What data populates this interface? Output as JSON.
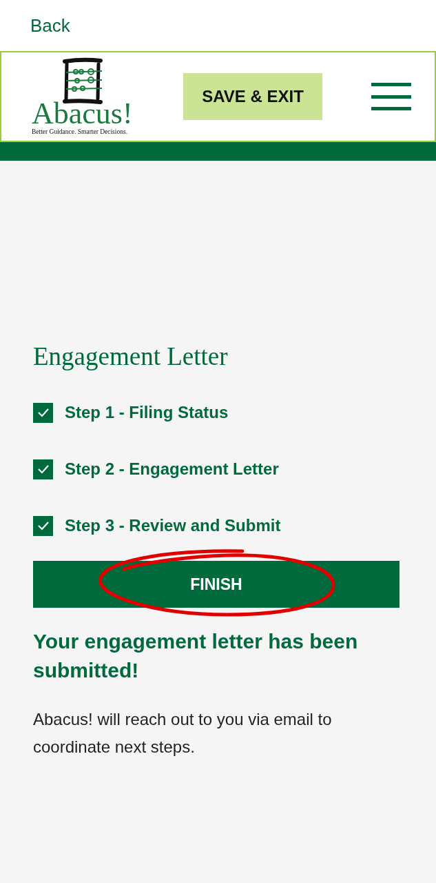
{
  "top_bar": {
    "back_link": "Back"
  },
  "header": {
    "logo": {
      "name": "Abacus!",
      "tagline": "Better Guidance. Smarter Decisions."
    },
    "save_button": "SAVE & EXIT"
  },
  "title": "Engagement Letter",
  "steps": [
    {
      "label": "Step 1 - Filing Status",
      "checked": true
    },
    {
      "label": "Step 2 - Engagement Letter",
      "checked": true
    },
    {
      "label": "Step 3 - Review and Submit",
      "checked": true
    }
  ],
  "finish_button": "FINISH",
  "confirmation": {
    "heading": "Your engagement letter has been submitted!",
    "message": "Abacus! will reach out to you via email to coordinate next steps."
  }
}
